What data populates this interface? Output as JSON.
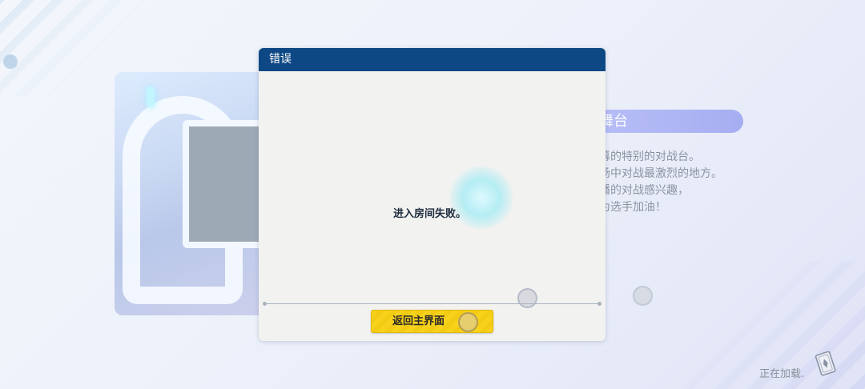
{
  "background": {
    "stage_tag": "舞台",
    "stage_desc_lines": [
      "幕的特别的对战台。",
      "场中对战最激烈的地方。",
      "播的对战感兴趣，",
      "为选手加油！"
    ]
  },
  "dialog": {
    "title": "错误",
    "message": "进入房间失败。",
    "return_button_label": "返回主界面"
  },
  "status": {
    "loading_text": "正在加载."
  },
  "colors": {
    "header": "#0e4884",
    "button": "#f6d21c",
    "tag": "#b7bef6"
  },
  "icons": {
    "loading": "card-icon"
  }
}
